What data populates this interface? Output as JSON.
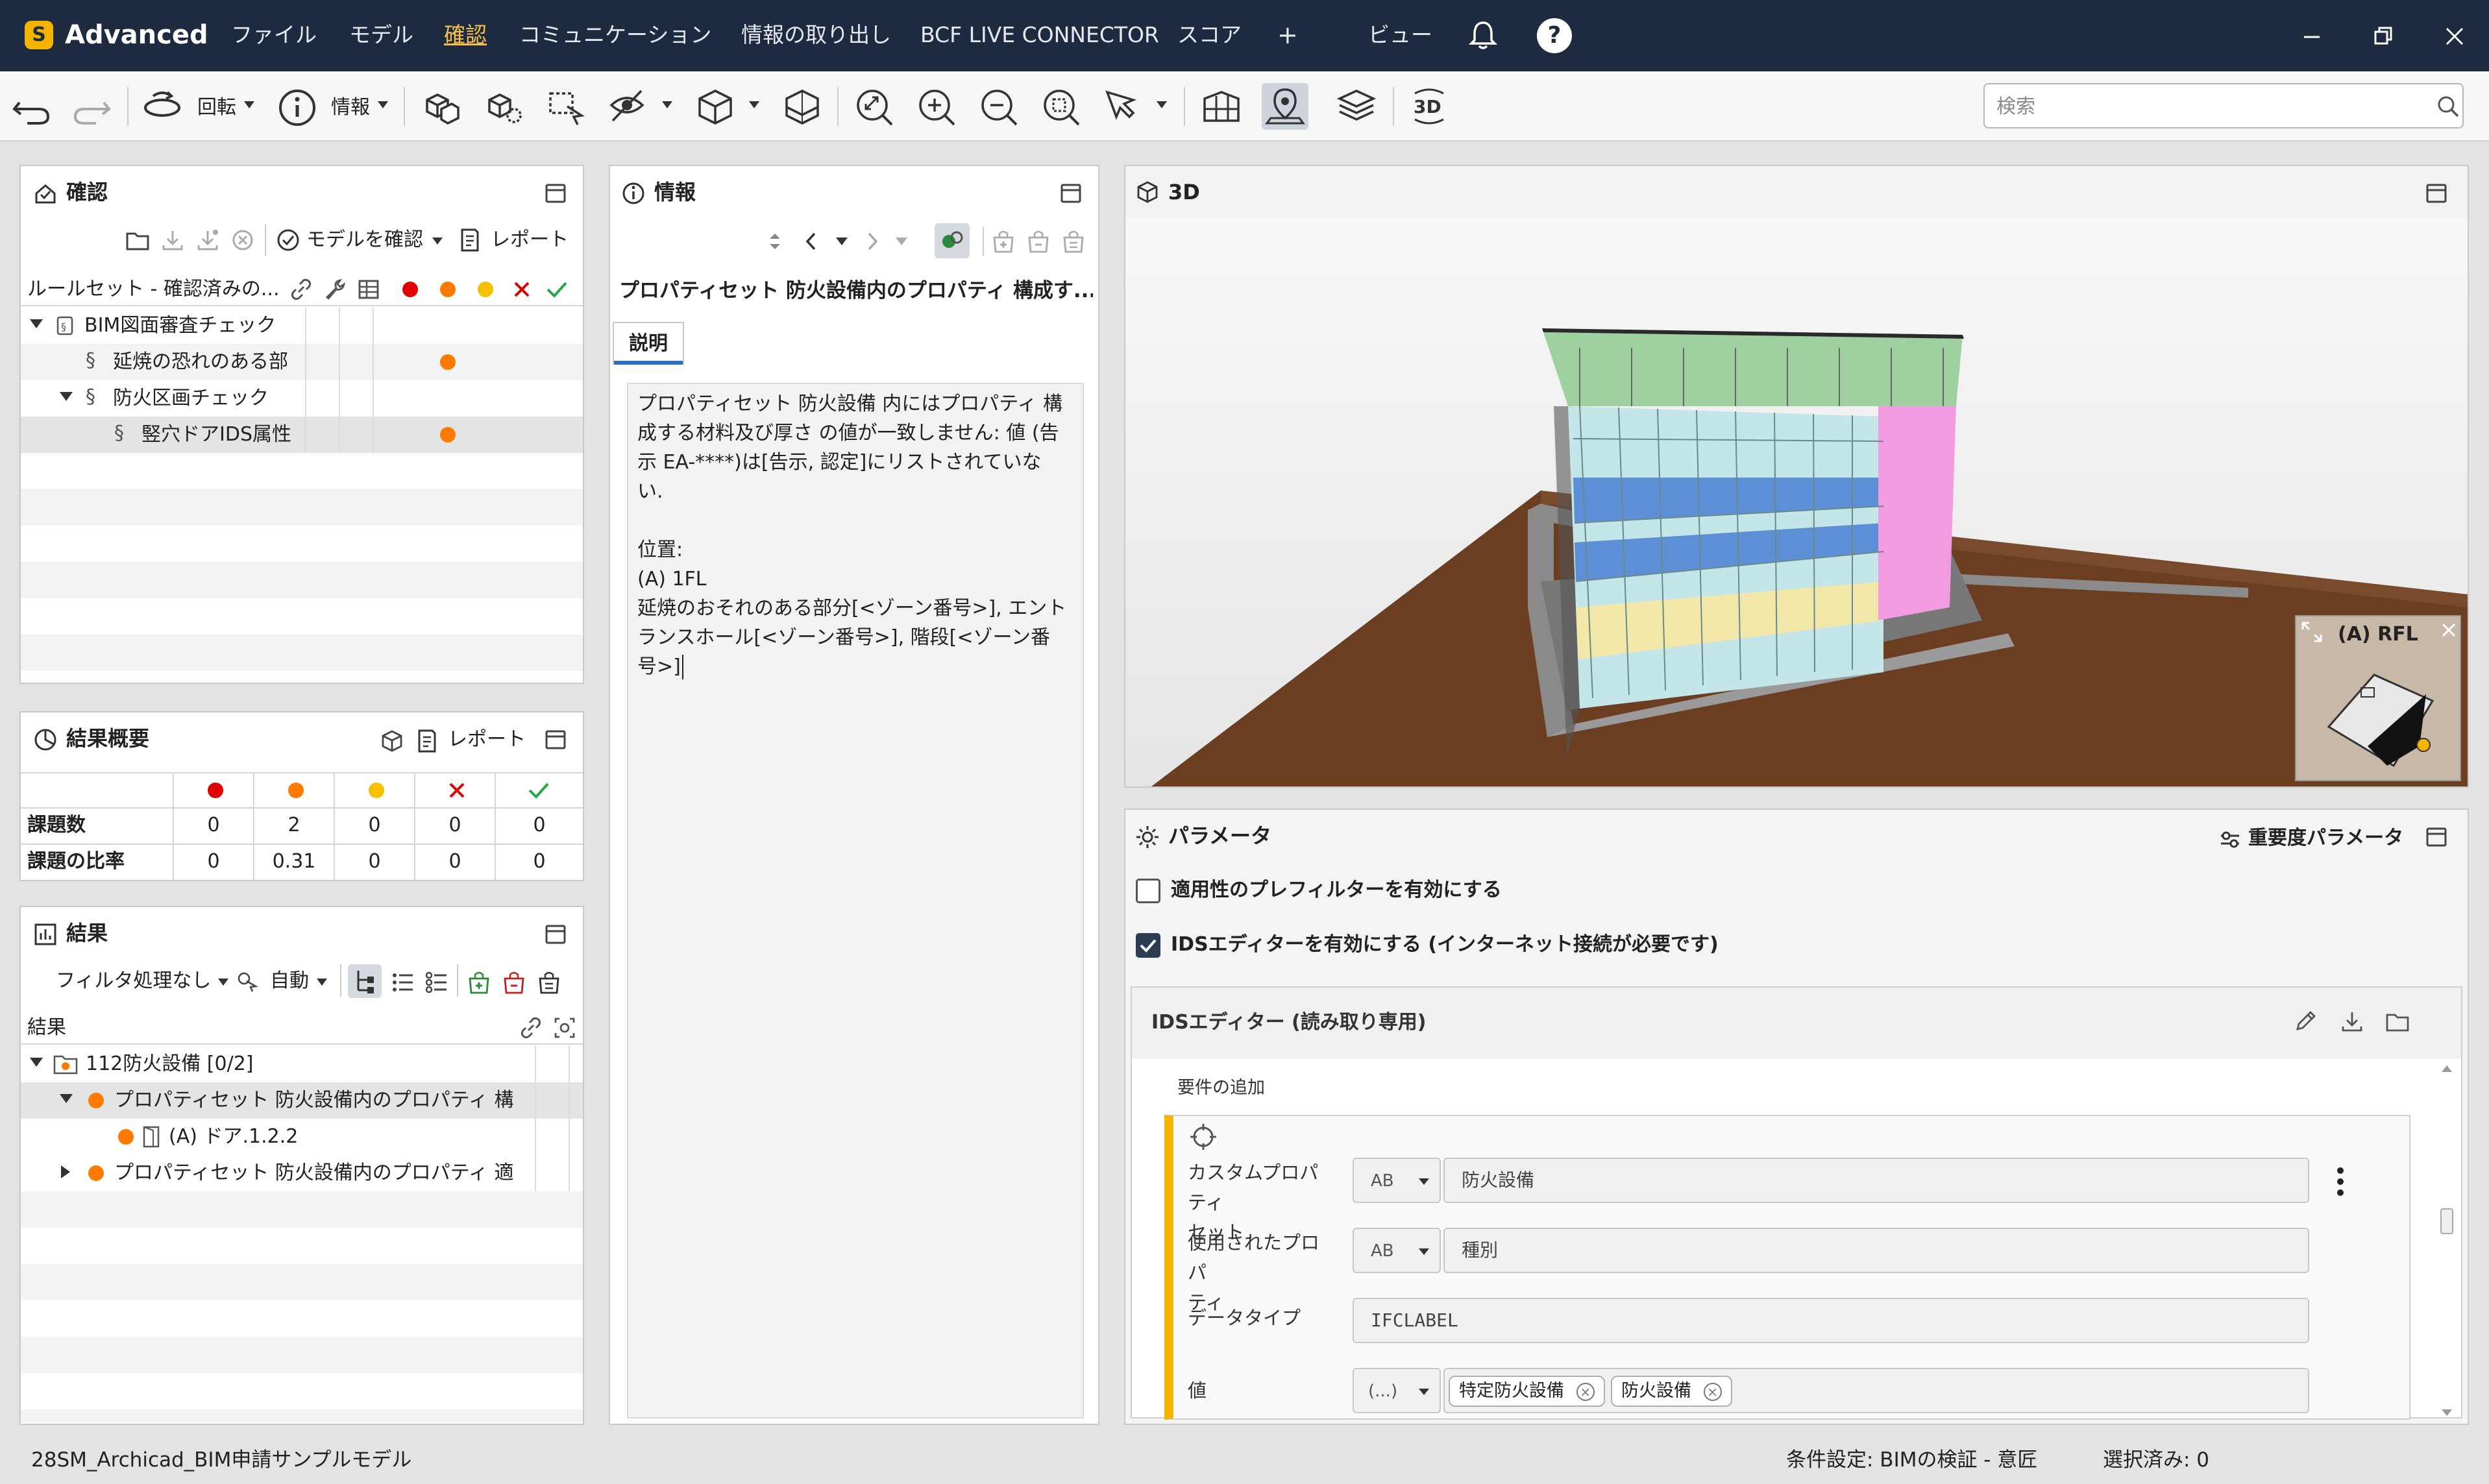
{
  "app": {
    "name": "Advanced",
    "icon": "app-logo-icon"
  },
  "menu": {
    "items": [
      {
        "label": "ファイル",
        "active": false
      },
      {
        "label": "モデル",
        "active": false
      },
      {
        "label": "確認",
        "active": true
      },
      {
        "label": "コミュニケーション",
        "active": false
      },
      {
        "label": "情報の取り出し",
        "active": false
      },
      {
        "label": "BCF LIVE CONNECTOR",
        "active": false
      },
      {
        "label": "スコア",
        "active": false
      }
    ],
    "add": "+",
    "view": "ビュー"
  },
  "toolbar": {
    "rotate_label": "回転",
    "info_label": "情報",
    "search_placeholder": "検索"
  },
  "check_panel": {
    "title": "確認",
    "check_model_label": "モデルを確認",
    "report_label": "レポート",
    "ruleset_header": "ルールセット - 確認済みの...",
    "tree": [
      {
        "label": "BIM図面審査チェック",
        "level": 0,
        "expanded": true,
        "status": ""
      },
      {
        "label": "延焼の恐れのある部",
        "level": 1,
        "expanded": false,
        "status": "orange"
      },
      {
        "label": "防火区画チェック",
        "level": 1,
        "expanded": true,
        "status": ""
      },
      {
        "label": "竪穴ドアIDS属性",
        "level": 2,
        "expanded": false,
        "status": "orange",
        "selected": true
      }
    ]
  },
  "summary_panel": {
    "title": "結果概要",
    "report_label": "レポート",
    "rows": [
      {
        "label": "課題数",
        "values": [
          "0",
          "2",
          "0",
          "0",
          "0"
        ]
      },
      {
        "label": "課題の比率",
        "values": [
          "0",
          "0.31",
          "0",
          "0",
          "0"
        ]
      }
    ]
  },
  "results_panel": {
    "title": "結果",
    "filter_label": "フィルタ処理なし",
    "auto_label": "自動",
    "column_header": "結果",
    "tree": [
      {
        "label": "112防火設備 [0/2]",
        "level": 0,
        "icon": "folder-warning-icon"
      },
      {
        "label": "プロパティセット 防火設備内のプロパティ 構",
        "level": 1,
        "status": "orange",
        "selected": true
      },
      {
        "label": "(A) ドア.1.2.2",
        "level": 2,
        "status": "orange"
      },
      {
        "label": "プロパティセット 防火設備内のプロパティ 適",
        "level": 1,
        "status": "orange"
      }
    ]
  },
  "info_panel": {
    "title": "情報",
    "heading": "プロパティセット 防火設備内のプロパティ 構成す...",
    "tab_label": "説明",
    "description_lines": [
      "プロパティセット 防火設備 内にはプロパティ 構",
      "成する材料及び厚さ の値が一致しません: 値 (告",
      "示 EA-****)は[告示, 認定]にリストされていな",
      "い.",
      "",
      "位置:",
      "(A) 1FL",
      "延焼のおそれのある部分[<ゾーン番号>], エント",
      "ランスホール[<ゾーン番号>], 階段[<ゾーン番",
      "号>]"
    ]
  },
  "view3d_panel": {
    "title": "3D",
    "minimap_label": "(A) RFL"
  },
  "params_panel": {
    "title": "パラメータ",
    "severity_label": "重要度パラメータ",
    "prefilter_label": "適用性のプレフィルターを有効にする",
    "prefilter_checked": false,
    "ids_editor_label": "IDSエディターを有効にする (インターネット接続が必要です)",
    "ids_editor_checked": true,
    "ids_title": "IDSエディター (読み取り専用)",
    "requirement_add": "要件の追加",
    "fields": [
      {
        "label_lines": [
          "カスタムプロパティ",
          "セット"
        ],
        "type": "AB",
        "value": "防火設備"
      },
      {
        "label_lines": [
          "使用されたプロパ",
          "ティ"
        ],
        "type": "AB",
        "value": "種別"
      },
      {
        "label_lines": [
          "データタイプ"
        ],
        "type": "",
        "value": "IFCLABEL"
      },
      {
        "label_lines": [
          "値"
        ],
        "type": "(...)",
        "value": ""
      }
    ],
    "value_chips": [
      "特定防火設備",
      "防火設備"
    ]
  },
  "status": {
    "model_name": "28SM_Archicad_BIM申請サンプルモデル",
    "condition": "条件設定: BIMの検証 - 意匠",
    "selected": "選択済み: 0"
  },
  "colors": {
    "titlebar": "#1e2a40",
    "accent": "#f5b400",
    "issue_critical": "#e00000",
    "issue_major": "#ff7a00",
    "issue_minor": "#f9c000",
    "fail": "#e00000",
    "pass": "#22aa44"
  }
}
